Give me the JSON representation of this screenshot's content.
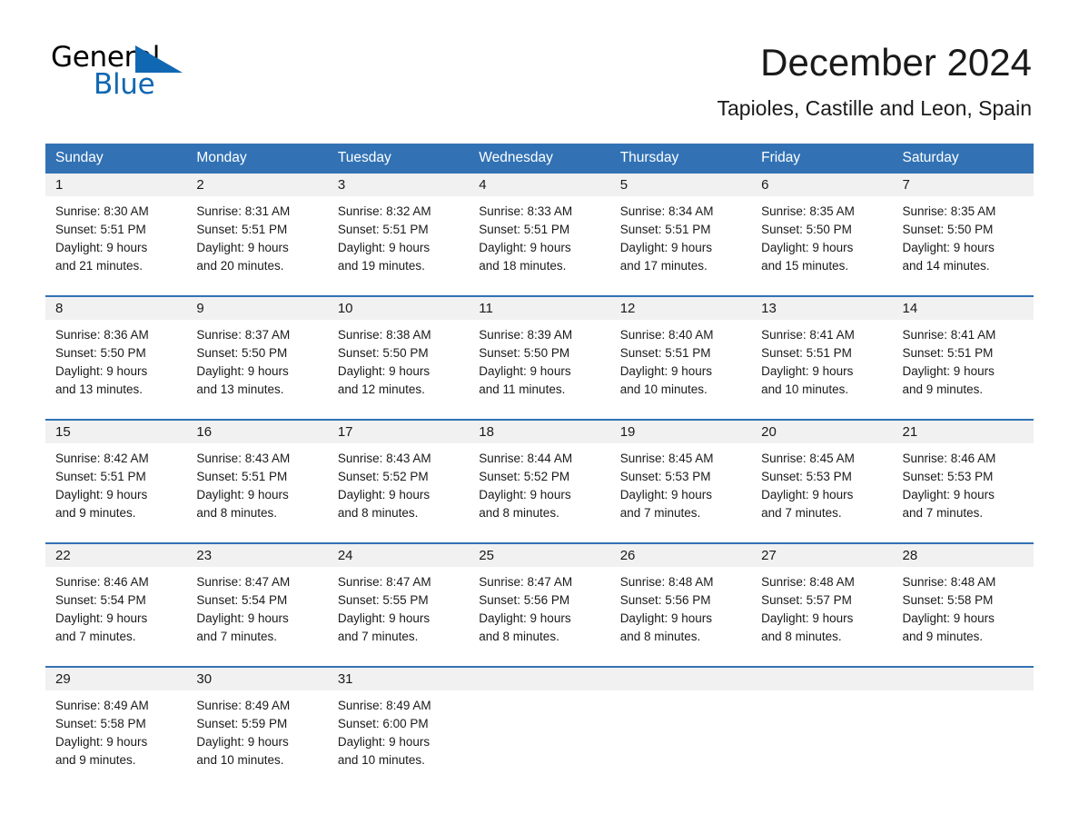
{
  "brand": {
    "name_part1": "General",
    "name_part2": "Blue",
    "triangle_color": "#1068b3"
  },
  "header": {
    "month_title": "December 2024",
    "location": "Tapioles, Castille and Leon, Spain"
  },
  "theme": {
    "header_blue": "#3272b4",
    "daynum_band": "#f1f1f1",
    "text": "#1a1a1a"
  },
  "weekday_headers": [
    "Sunday",
    "Monday",
    "Tuesday",
    "Wednesday",
    "Thursday",
    "Friday",
    "Saturday"
  ],
  "weeks": [
    [
      {
        "day": "1",
        "sunrise": "Sunrise: 8:30 AM",
        "sunset": "Sunset: 5:51 PM",
        "daylight_1": "Daylight: 9 hours",
        "daylight_2": "and 21 minutes."
      },
      {
        "day": "2",
        "sunrise": "Sunrise: 8:31 AM",
        "sunset": "Sunset: 5:51 PM",
        "daylight_1": "Daylight: 9 hours",
        "daylight_2": "and 20 minutes."
      },
      {
        "day": "3",
        "sunrise": "Sunrise: 8:32 AM",
        "sunset": "Sunset: 5:51 PM",
        "daylight_1": "Daylight: 9 hours",
        "daylight_2": "and 19 minutes."
      },
      {
        "day": "4",
        "sunrise": "Sunrise: 8:33 AM",
        "sunset": "Sunset: 5:51 PM",
        "daylight_1": "Daylight: 9 hours",
        "daylight_2": "and 18 minutes."
      },
      {
        "day": "5",
        "sunrise": "Sunrise: 8:34 AM",
        "sunset": "Sunset: 5:51 PM",
        "daylight_1": "Daylight: 9 hours",
        "daylight_2": "and 17 minutes."
      },
      {
        "day": "6",
        "sunrise": "Sunrise: 8:35 AM",
        "sunset": "Sunset: 5:50 PM",
        "daylight_1": "Daylight: 9 hours",
        "daylight_2": "and 15 minutes."
      },
      {
        "day": "7",
        "sunrise": "Sunrise: 8:35 AM",
        "sunset": "Sunset: 5:50 PM",
        "daylight_1": "Daylight: 9 hours",
        "daylight_2": "and 14 minutes."
      }
    ],
    [
      {
        "day": "8",
        "sunrise": "Sunrise: 8:36 AM",
        "sunset": "Sunset: 5:50 PM",
        "daylight_1": "Daylight: 9 hours",
        "daylight_2": "and 13 minutes."
      },
      {
        "day": "9",
        "sunrise": "Sunrise: 8:37 AM",
        "sunset": "Sunset: 5:50 PM",
        "daylight_1": "Daylight: 9 hours",
        "daylight_2": "and 13 minutes."
      },
      {
        "day": "10",
        "sunrise": "Sunrise: 8:38 AM",
        "sunset": "Sunset: 5:50 PM",
        "daylight_1": "Daylight: 9 hours",
        "daylight_2": "and 12 minutes."
      },
      {
        "day": "11",
        "sunrise": "Sunrise: 8:39 AM",
        "sunset": "Sunset: 5:50 PM",
        "daylight_1": "Daylight: 9 hours",
        "daylight_2": "and 11 minutes."
      },
      {
        "day": "12",
        "sunrise": "Sunrise: 8:40 AM",
        "sunset": "Sunset: 5:51 PM",
        "daylight_1": "Daylight: 9 hours",
        "daylight_2": "and 10 minutes."
      },
      {
        "day": "13",
        "sunrise": "Sunrise: 8:41 AM",
        "sunset": "Sunset: 5:51 PM",
        "daylight_1": "Daylight: 9 hours",
        "daylight_2": "and 10 minutes."
      },
      {
        "day": "14",
        "sunrise": "Sunrise: 8:41 AM",
        "sunset": "Sunset: 5:51 PM",
        "daylight_1": "Daylight: 9 hours",
        "daylight_2": "and 9 minutes."
      }
    ],
    [
      {
        "day": "15",
        "sunrise": "Sunrise: 8:42 AM",
        "sunset": "Sunset: 5:51 PM",
        "daylight_1": "Daylight: 9 hours",
        "daylight_2": "and 9 minutes."
      },
      {
        "day": "16",
        "sunrise": "Sunrise: 8:43 AM",
        "sunset": "Sunset: 5:51 PM",
        "daylight_1": "Daylight: 9 hours",
        "daylight_2": "and 8 minutes."
      },
      {
        "day": "17",
        "sunrise": "Sunrise: 8:43 AM",
        "sunset": "Sunset: 5:52 PM",
        "daylight_1": "Daylight: 9 hours",
        "daylight_2": "and 8 minutes."
      },
      {
        "day": "18",
        "sunrise": "Sunrise: 8:44 AM",
        "sunset": "Sunset: 5:52 PM",
        "daylight_1": "Daylight: 9 hours",
        "daylight_2": "and 8 minutes."
      },
      {
        "day": "19",
        "sunrise": "Sunrise: 8:45 AM",
        "sunset": "Sunset: 5:53 PM",
        "daylight_1": "Daylight: 9 hours",
        "daylight_2": "and 7 minutes."
      },
      {
        "day": "20",
        "sunrise": "Sunrise: 8:45 AM",
        "sunset": "Sunset: 5:53 PM",
        "daylight_1": "Daylight: 9 hours",
        "daylight_2": "and 7 minutes."
      },
      {
        "day": "21",
        "sunrise": "Sunrise: 8:46 AM",
        "sunset": "Sunset: 5:53 PM",
        "daylight_1": "Daylight: 9 hours",
        "daylight_2": "and 7 minutes."
      }
    ],
    [
      {
        "day": "22",
        "sunrise": "Sunrise: 8:46 AM",
        "sunset": "Sunset: 5:54 PM",
        "daylight_1": "Daylight: 9 hours",
        "daylight_2": "and 7 minutes."
      },
      {
        "day": "23",
        "sunrise": "Sunrise: 8:47 AM",
        "sunset": "Sunset: 5:54 PM",
        "daylight_1": "Daylight: 9 hours",
        "daylight_2": "and 7 minutes."
      },
      {
        "day": "24",
        "sunrise": "Sunrise: 8:47 AM",
        "sunset": "Sunset: 5:55 PM",
        "daylight_1": "Daylight: 9 hours",
        "daylight_2": "and 7 minutes."
      },
      {
        "day": "25",
        "sunrise": "Sunrise: 8:47 AM",
        "sunset": "Sunset: 5:56 PM",
        "daylight_1": "Daylight: 9 hours",
        "daylight_2": "and 8 minutes."
      },
      {
        "day": "26",
        "sunrise": "Sunrise: 8:48 AM",
        "sunset": "Sunset: 5:56 PM",
        "daylight_1": "Daylight: 9 hours",
        "daylight_2": "and 8 minutes."
      },
      {
        "day": "27",
        "sunrise": "Sunrise: 8:48 AM",
        "sunset": "Sunset: 5:57 PM",
        "daylight_1": "Daylight: 9 hours",
        "daylight_2": "and 8 minutes."
      },
      {
        "day": "28",
        "sunrise": "Sunrise: 8:48 AM",
        "sunset": "Sunset: 5:58 PM",
        "daylight_1": "Daylight: 9 hours",
        "daylight_2": "and 9 minutes."
      }
    ],
    [
      {
        "day": "29",
        "sunrise": "Sunrise: 8:49 AM",
        "sunset": "Sunset: 5:58 PM",
        "daylight_1": "Daylight: 9 hours",
        "daylight_2": "and 9 minutes."
      },
      {
        "day": "30",
        "sunrise": "Sunrise: 8:49 AM",
        "sunset": "Sunset: 5:59 PM",
        "daylight_1": "Daylight: 9 hours",
        "daylight_2": "and 10 minutes."
      },
      {
        "day": "31",
        "sunrise": "Sunrise: 8:49 AM",
        "sunset": "Sunset: 6:00 PM",
        "daylight_1": "Daylight: 9 hours",
        "daylight_2": "and 10 minutes."
      },
      {
        "day": "",
        "sunrise": "",
        "sunset": "",
        "daylight_1": "",
        "daylight_2": ""
      },
      {
        "day": "",
        "sunrise": "",
        "sunset": "",
        "daylight_1": "",
        "daylight_2": ""
      },
      {
        "day": "",
        "sunrise": "",
        "sunset": "",
        "daylight_1": "",
        "daylight_2": ""
      },
      {
        "day": "",
        "sunrise": "",
        "sunset": "",
        "daylight_1": "",
        "daylight_2": ""
      }
    ]
  ]
}
